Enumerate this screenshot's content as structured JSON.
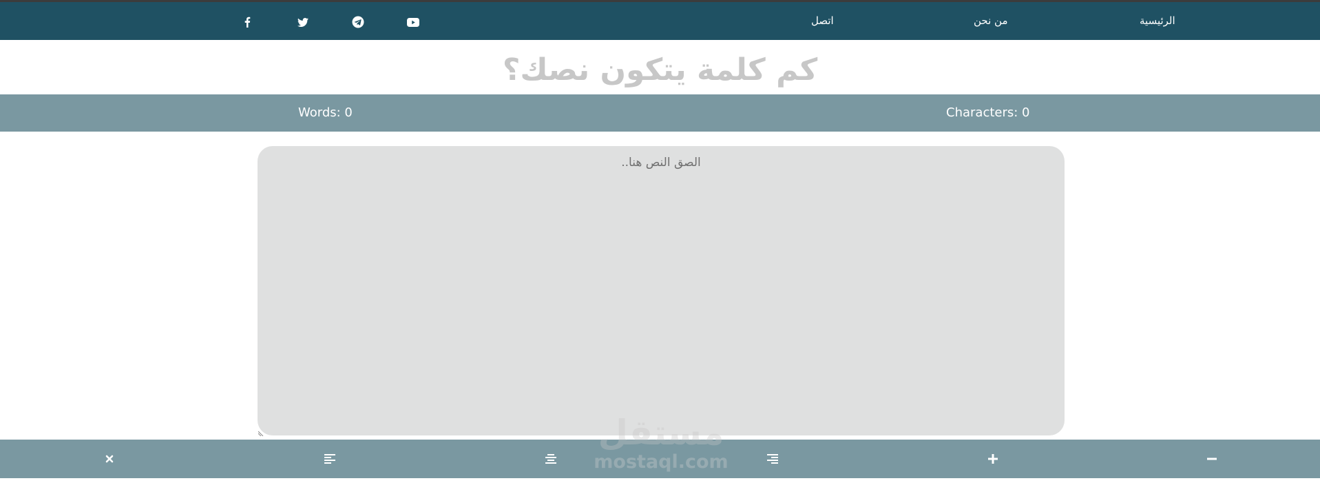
{
  "nav": {
    "links": {
      "home": "الرئيسية",
      "about": "من نحن",
      "contact": "اتصل"
    },
    "social": [
      "facebook-icon",
      "twitter-icon",
      "telegram-icon",
      "youtube-icon"
    ]
  },
  "headline": "كم كلمة يتكون نصك؟",
  "stats": {
    "words": "Words: 0",
    "characters": "Characters: 0"
  },
  "editor": {
    "placeholder": "الصق النص هنا..",
    "value": ""
  },
  "toolbar": {
    "buttons": [
      "clear-icon",
      "align-left-icon",
      "align-center-icon",
      "align-right-icon",
      "font-increase-icon",
      "font-decrease-icon"
    ]
  },
  "watermark": {
    "arabic": "مستقل",
    "latin": "mostaql.com"
  },
  "colors": {
    "navbar": "#1f5163",
    "bars": "#7a98a1",
    "editor_bg": "#dfe0e0",
    "headline": "#c7c7c7"
  }
}
